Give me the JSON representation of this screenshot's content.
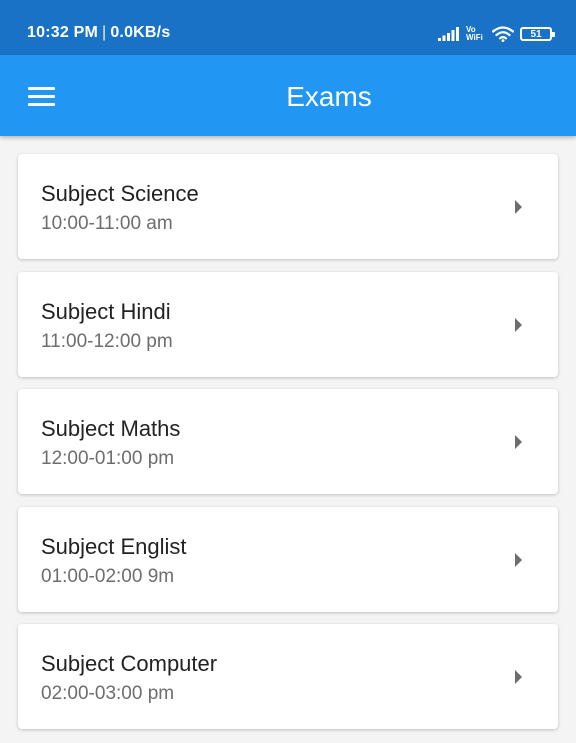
{
  "status_bar": {
    "time": "10:32 PM",
    "separator": "|",
    "network_speed": "0.0KB/s",
    "vowifi_top": "Vo",
    "vowifi_bottom": "WiFi",
    "battery": "51",
    "icons": [
      "signal-icon",
      "vowifi-icon",
      "wifi-icon",
      "battery-icon"
    ]
  },
  "app_bar": {
    "title": "Exams",
    "menu_icon": "menu-icon",
    "color": "#2196f3"
  },
  "exams": [
    {
      "subject": "Subject Science",
      "time": "10:00-11:00 am"
    },
    {
      "subject": "Subject Hindi",
      "time": "11:00-12:00 pm"
    },
    {
      "subject": "Subject Maths",
      "time": "12:00-01:00 pm"
    },
    {
      "subject": "Subject Englist",
      "time": "01:00-02:00 9m"
    },
    {
      "subject": "Subject Computer",
      "time": "02:00-03:00 pm"
    }
  ],
  "colors": {
    "status_bar": "#1a72c6",
    "app_bar": "#2196f3",
    "background": "#f4f4f4",
    "card": "#ffffff"
  }
}
